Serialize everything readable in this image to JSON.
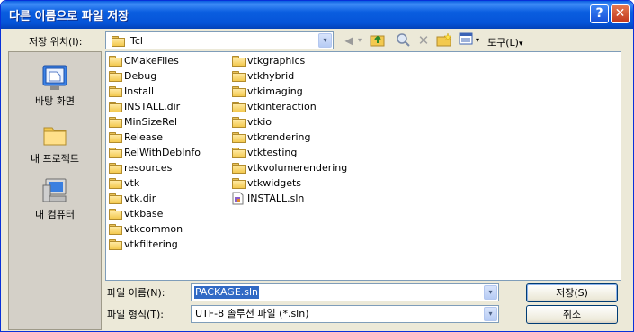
{
  "window": {
    "title": "다른 이름으로 파일 저장",
    "help_glyph": "?",
    "close_glyph": "✕"
  },
  "toolbar": {
    "location_label": "저장 위치(I):",
    "location_value": "Tcl",
    "view_menu_label": "도구(L)",
    "view_menu_arrow": "▾",
    "dropdown_arrow": "▾"
  },
  "places": [
    {
      "label": "바탕 화면",
      "icon": "desktop-icon"
    },
    {
      "label": "내 프로젝트",
      "icon": "my-projects-folder-icon"
    },
    {
      "label": "내 컴퓨터",
      "icon": "my-computer-icon"
    }
  ],
  "files": {
    "column1": [
      "CMakeFiles",
      "Debug",
      "Install",
      "INSTALL.dir",
      "MinSizeRel",
      "Release",
      "RelWithDebInfo",
      "resources",
      "vtk",
      "vtk.dir",
      "vtkbase",
      "vtkcommon",
      "vtkfiltering"
    ],
    "column2": [
      "vtkgraphics",
      "vtkhybrid",
      "vtkimaging",
      "vtkinteraction",
      "vtkio",
      "vtkrendering",
      "vtktesting",
      "vtkvolumerendering",
      "vtkwidgets"
    ],
    "column2_file": "INSTALL.sln"
  },
  "form": {
    "filename_label": "파일 이름(N):",
    "filename_value": "PACKAGE.sln",
    "filetype_label": "파일 형식(T):",
    "filetype_value": "UTF-8 솔루션 파일 (*.sln)"
  },
  "buttons": {
    "save": "저장(S)",
    "cancel": "취소"
  }
}
